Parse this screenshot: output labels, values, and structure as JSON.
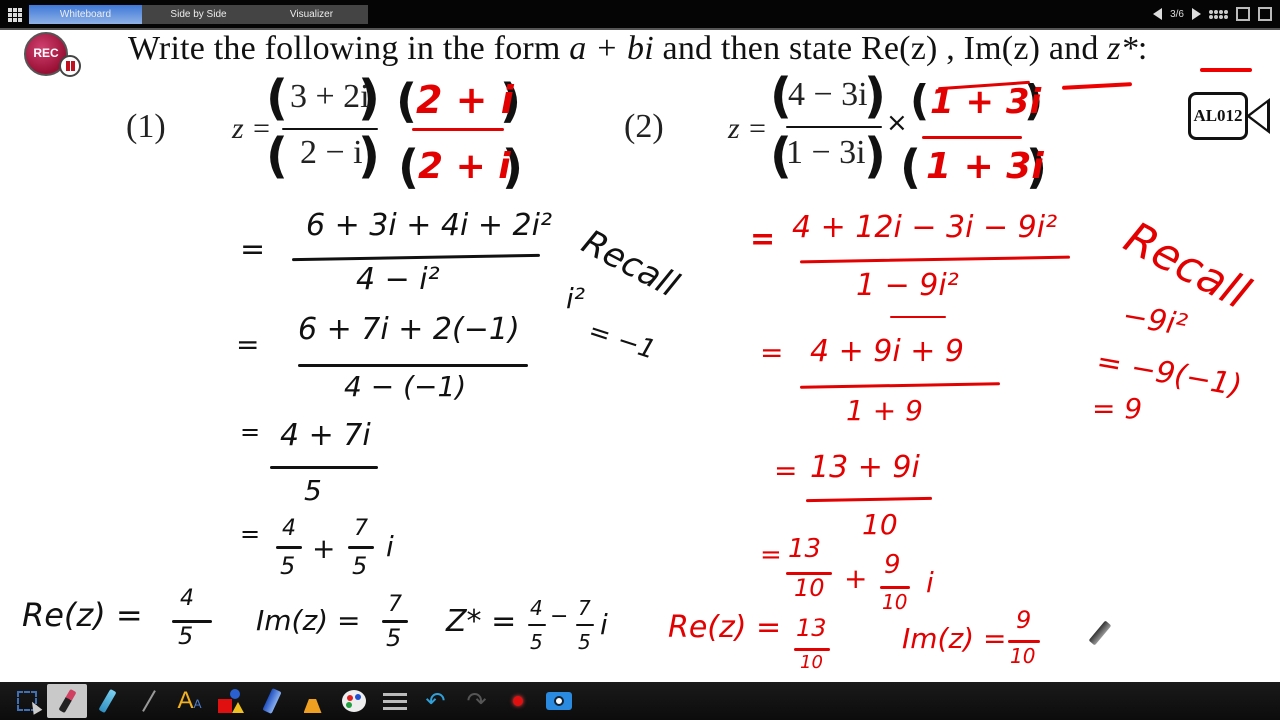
{
  "topbar": {
    "tabs": [
      {
        "label": "Whiteboard",
        "active": true
      },
      {
        "label": "Side by Side",
        "active": false
      },
      {
        "label": "Visualizer",
        "active": false
      }
    ],
    "page_indicator": "3/6",
    "icons": [
      "apps-grid-icon",
      "prev-page-icon",
      "next-page-icon",
      "page-sorter-icon",
      "new-page-icon",
      "export-page-icon"
    ]
  },
  "recording": {
    "label": "REC",
    "state": "paused"
  },
  "question": {
    "prefix": "Write the following in the form ",
    "form": "a + bi",
    "middle": " and then state ",
    "re": "Re(z)",
    "sep": " , ",
    "im": "Im(z)",
    "and": " and ",
    "conj": "z*",
    "end": ":"
  },
  "camera_badge": "AL012",
  "problem1": {
    "number": "(1)",
    "lhs": "z =",
    "numerator": "3 + 2i",
    "denominator": "2 − i",
    "multiplier_num": "2 + i",
    "multiplier_den": "2 + i",
    "steps": [
      {
        "eq": "=",
        "num": "6 + 3i + 4i + 2i²",
        "den": "4 − i²"
      },
      {
        "eq": "=",
        "num": "6 + 7i + 2(−1)",
        "den": "4 − (−1)"
      },
      {
        "eq": "=",
        "num": "4 + 7i",
        "den": "5"
      }
    ],
    "final": {
      "eq": "=",
      "a_num": "4",
      "a_den": "5",
      "plus": "+",
      "b_num": "7",
      "b_den": "5",
      "i": "i"
    },
    "recall": {
      "title": "Recall",
      "line1": "i²",
      "line2": "= −1"
    },
    "answers": {
      "re_label": "Re(z) =",
      "re_num": "4",
      "re_den": "5",
      "im_label": "Im(z) =",
      "im_num": "7",
      "im_den": "5",
      "conj_label": "Z* =",
      "conj_a_num": "4",
      "conj_a_den": "5",
      "conj_minus": "−",
      "conj_b_num": "7",
      "conj_b_den": "5",
      "conj_i": "i"
    }
  },
  "problem2": {
    "number": "(2)",
    "lhs": "z =",
    "numerator": "4 − 3i",
    "denominator": "1 − 3i",
    "times": "×",
    "multiplier_num": "1 + 3i",
    "multiplier_den": "1 + 3i",
    "steps": [
      {
        "eq": "=",
        "num": "4 + 12i − 3i − 9i²",
        "den": "1 − 9i²"
      },
      {
        "eq": "=",
        "num": "4 + 9i + 9",
        "den": "1 + 9"
      },
      {
        "eq": "=",
        "num": "13 + 9i",
        "den": "10"
      }
    ],
    "final": {
      "eq": "=",
      "a_num": "13",
      "a_den": "10",
      "plus": "+",
      "b_num": "9",
      "b_den": "10",
      "i": "i"
    },
    "recall": {
      "title": "Recall",
      "line1": "−9i²",
      "line2": "= −9(−1)",
      "line3": "= 9"
    },
    "answers": {
      "re_label": "Re(z) =",
      "re_num": "13",
      "re_den": "10",
      "im_label": "Im(z) =",
      "im_num": "9",
      "im_den": "10"
    }
  },
  "colors": {
    "ink_black": "#111111",
    "ink_red": "#e30000",
    "tab_active": "#3e78d8"
  },
  "toolbar": {
    "tools": [
      "select-tool",
      "pen-tool",
      "highlighter-tool",
      "line-tool",
      "text-tool",
      "shapes-tool",
      "eraser-tool",
      "clear-tool",
      "color-palette",
      "line-width",
      "undo",
      "redo",
      "record",
      "camera-capture"
    ],
    "active": "pen-tool"
  }
}
